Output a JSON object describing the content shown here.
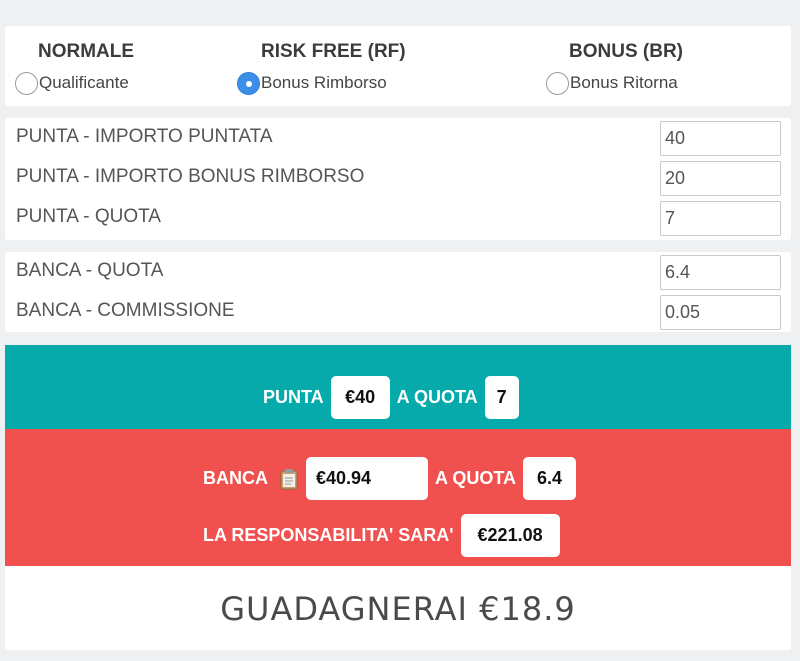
{
  "modes": [
    {
      "title": "NORMALE",
      "option": "Qualificante",
      "selected": false
    },
    {
      "title": "RISK FREE (RF)",
      "option": "Bonus Rimborso",
      "selected": true
    },
    {
      "title": "BONUS (BR)",
      "option": "Bonus Ritorna",
      "selected": false
    }
  ],
  "punta": {
    "importo_label": "PUNTA - IMPORTO PUNTATA",
    "importo_value": "40",
    "bonus_label": "PUNTA - IMPORTO BONUS RIMBORSO",
    "bonus_value": "20",
    "quota_label": "PUNTA - QUOTA",
    "quota_value": "7"
  },
  "banca": {
    "quota_label": "BANCA - QUOTA",
    "quota_value": "6.4",
    "commissione_label": "BANCA - COMMISSIONE",
    "commissione_value": "0.05"
  },
  "result": {
    "punta_label": "PUNTA",
    "punta_amount": "€40",
    "a_quota_label": "A QUOTA",
    "punta_quota": "7",
    "banca_label": "BANCA",
    "banca_amount": "€40.94",
    "banca_quota": "6.4",
    "responsabilita_label": "LA RESPONSABILITA' SARA'",
    "responsabilita_amount": "€221.08",
    "clipboard_icon": "clipboard-icon"
  },
  "profit": {
    "text": "GUADAGNERAI €18.9"
  },
  "colors": {
    "teal": "#06aaaa",
    "red": "#f0514f",
    "radio_checked": "#3b8fe8"
  }
}
